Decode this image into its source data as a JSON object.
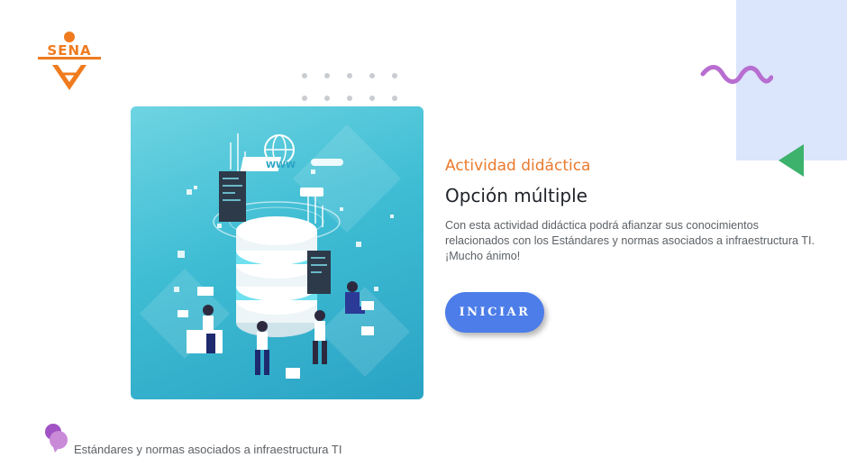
{
  "brand": {
    "logo_text": "SENA",
    "color": "#f07b1e"
  },
  "activity": {
    "subtitle": "Actividad didáctica",
    "title": "Opción múltiple",
    "description": "Con esta actividad didáctica podrá afianzar sus conocimientos relacionados con los  Estándares y normas asociados a infraestructura TI. ¡Mucho ánimo!"
  },
  "actions": {
    "start_label": "INICIAR"
  },
  "footer": {
    "course_name": "Estándares y normas asociados a infraestructura TI"
  },
  "illustration": {
    "sign_text": "WWW"
  },
  "icons": {
    "logo": "sena-logo-icon",
    "wave": "wave-decoration-icon",
    "triangle": "triangle-decoration-icon",
    "footer": "chat-bubbles-icon"
  },
  "colors": {
    "accent_orange": "#ea7a2c",
    "button_blue": "#4c7de8",
    "panel_blue": "#dbe5fb",
    "wave_purple": "#b86ed0",
    "triangle_green": "#3db26d",
    "footer_icon_purple": "#a152c4"
  }
}
